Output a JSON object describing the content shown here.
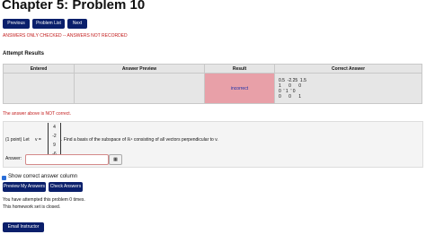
{
  "page": {
    "title": "Chapter 5: Problem 10",
    "nav": {
      "previous": "Previous",
      "problem_list": "Problem List",
      "next": "Next"
    },
    "warning": "ANSWERS ONLY CHECKED -- ANSWERS NOT RECORDED"
  },
  "attempt": {
    "heading": "Attempt Results",
    "columns": [
      "Entered",
      "Answer Preview",
      "Result",
      "Correct Answer"
    ],
    "row": {
      "entered": "",
      "preview": "",
      "result": "incorrect",
      "correct_answer": [
        "0.5  -2.25  1.5",
        "1      0      0",
        "0  ' 1  ' 0",
        "0      0      1"
      ]
    },
    "not_correct": "The answer above is NOT correct."
  },
  "problem": {
    "points": "(1 point) Let",
    "vector_name": "v",
    "vector": [
      "4",
      "-2",
      "9",
      "-6"
    ],
    "statement": ". Find a basis of the subspace of ℝ⁴ consisting of all vectors perpendicular to v.",
    "answer_label": "Answer:",
    "answer_value": "",
    "grid_icon": "matrix-grid-icon"
  },
  "controls": {
    "show_correct": "Show correct answer column",
    "preview_button": "Preview My Answers",
    "check_button": "Check Answers"
  },
  "status": {
    "attempts": "You have attempted this problem 0 times.",
    "closed": "This homework set is closed."
  },
  "email_button": "Email Instructor"
}
